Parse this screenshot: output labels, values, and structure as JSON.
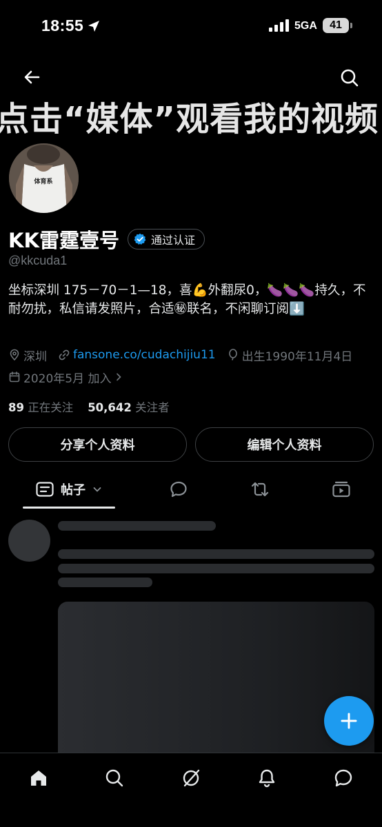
{
  "status_bar": {
    "time": "18:55",
    "network": "5GA",
    "battery": "41"
  },
  "header": {
    "banner_text": "点击“媒体”观看我的视频"
  },
  "profile": {
    "avatar_shirt_text": "体育系",
    "display_name": "KK雷霆壹号",
    "verified_label": "通过认证",
    "handle": "@kkcuda1",
    "bio": "坐标深圳 175－70－1—18，喜💪外翻尿0，🍆🍆🍆持久，不耐勿扰，私信请发照片，合适㊙联名，不闲聊订阅⬇️",
    "location": "深圳",
    "link": "fansone.co/cudachijiu11",
    "birthday": "出生1990年11月4日",
    "joined": "2020年5月 加入",
    "following_count": "89",
    "following_label": "正在关注",
    "followers_count": "50,642",
    "followers_label": "关注者"
  },
  "actions": {
    "share_label": "分享个人资料",
    "edit_label": "编辑个人资料"
  },
  "tabs": {
    "posts_label": "帖子"
  },
  "colors": {
    "accent": "#1d9bf0",
    "background": "#000000",
    "muted_text": "#71767b",
    "primary_text": "#e7e9ea"
  },
  "icons": [
    "location-arrow-icon",
    "signal-icon",
    "battery-icon",
    "back-arrow-icon",
    "search-icon",
    "verified-badge-icon",
    "location-pin-icon",
    "link-icon",
    "birthday-balloon-icon",
    "calendar-icon",
    "chevron-right-icon",
    "posts-icon",
    "chevron-down-icon",
    "replies-icon",
    "retweet-icon",
    "media-icon",
    "plus-icon",
    "home-icon",
    "grok-icon",
    "bell-icon",
    "messages-icon"
  ]
}
